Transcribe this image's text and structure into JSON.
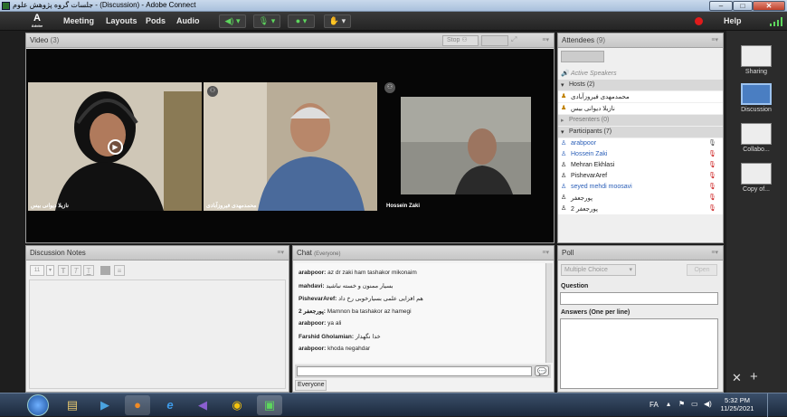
{
  "window": {
    "title": "جلسات گروه پژوهش علوم - (Discussion) - Adobe Connect"
  },
  "menubar": {
    "logo_text": "Adobe",
    "menus": [
      "Meeting",
      "Layouts",
      "Pods",
      "Audio"
    ],
    "help": "Help"
  },
  "video_pod": {
    "title": "Video",
    "count": "(3)",
    "stop_label": "Stop",
    "tiles": [
      {
        "name": "نازیلا دیوانی بیس"
      },
      {
        "name": "محمدمهدی فیروزآبادی"
      },
      {
        "name": "Hossein Zaki"
      }
    ]
  },
  "attendees": {
    "title": "Attendees",
    "count": "(9)",
    "active_speakers": "Active Speakers",
    "hosts_header": "Hosts (2)",
    "hosts": [
      "محمدمهدی فیروزآبادی",
      "نازیلا دیوانی بیس"
    ],
    "presenters_header": "Presenters (0)",
    "participants_header": "Participants (7)",
    "participants": [
      "arabpoor",
      "Hossein Zaki",
      "Mehran Ekhlasi",
      "PishevarAref",
      "seyed mehdi moosavi",
      "پورجعفر",
      "پورجعفر 2"
    ]
  },
  "sidebar": {
    "layouts": [
      "Sharing",
      "Discussion",
      "Collabo...",
      "Copy of..."
    ]
  },
  "notes_pod": {
    "title": "Discussion Notes",
    "font_size": "11"
  },
  "chat_pod": {
    "title": "Chat",
    "scope": "(Everyone)",
    "messages": [
      {
        "sender": "arabpoor:",
        "text": "az dr zaki ham tashakor mikonaim"
      },
      {
        "sender": "mahdavi:",
        "text": "بسیار ممنون و خسته نباشید"
      },
      {
        "sender": "PishevarAref:",
        "text": "هم افزایی علمی بسیارخوبی رخ داد"
      },
      {
        "sender": "پورجعفر 2:",
        "text": "Mamnon ba tashakor az hamegi"
      },
      {
        "sender": "arabpoor:",
        "text": "ya ali"
      },
      {
        "sender": "Farshid Gholamian:",
        "text": "خدا نگهدار"
      },
      {
        "sender": "arabpoor:",
        "text": "khoda negahdar"
      }
    ],
    "input_value": "",
    "recipient": "Everyone"
  },
  "poll_pod": {
    "title": "Poll",
    "type_select": "Multiple Choice",
    "open_label": "Open",
    "question_label": "Question",
    "question_value": "",
    "answers_label": "Answers (One per line)",
    "answers_value": ""
  },
  "taskbar": {
    "lang": "FA",
    "time": "5:32 PM",
    "date": "11/25/2021"
  },
  "colors": {
    "accent_green": "#5dd65d",
    "record_red": "#e01b1b",
    "link_blue": "#2b5fb8"
  }
}
